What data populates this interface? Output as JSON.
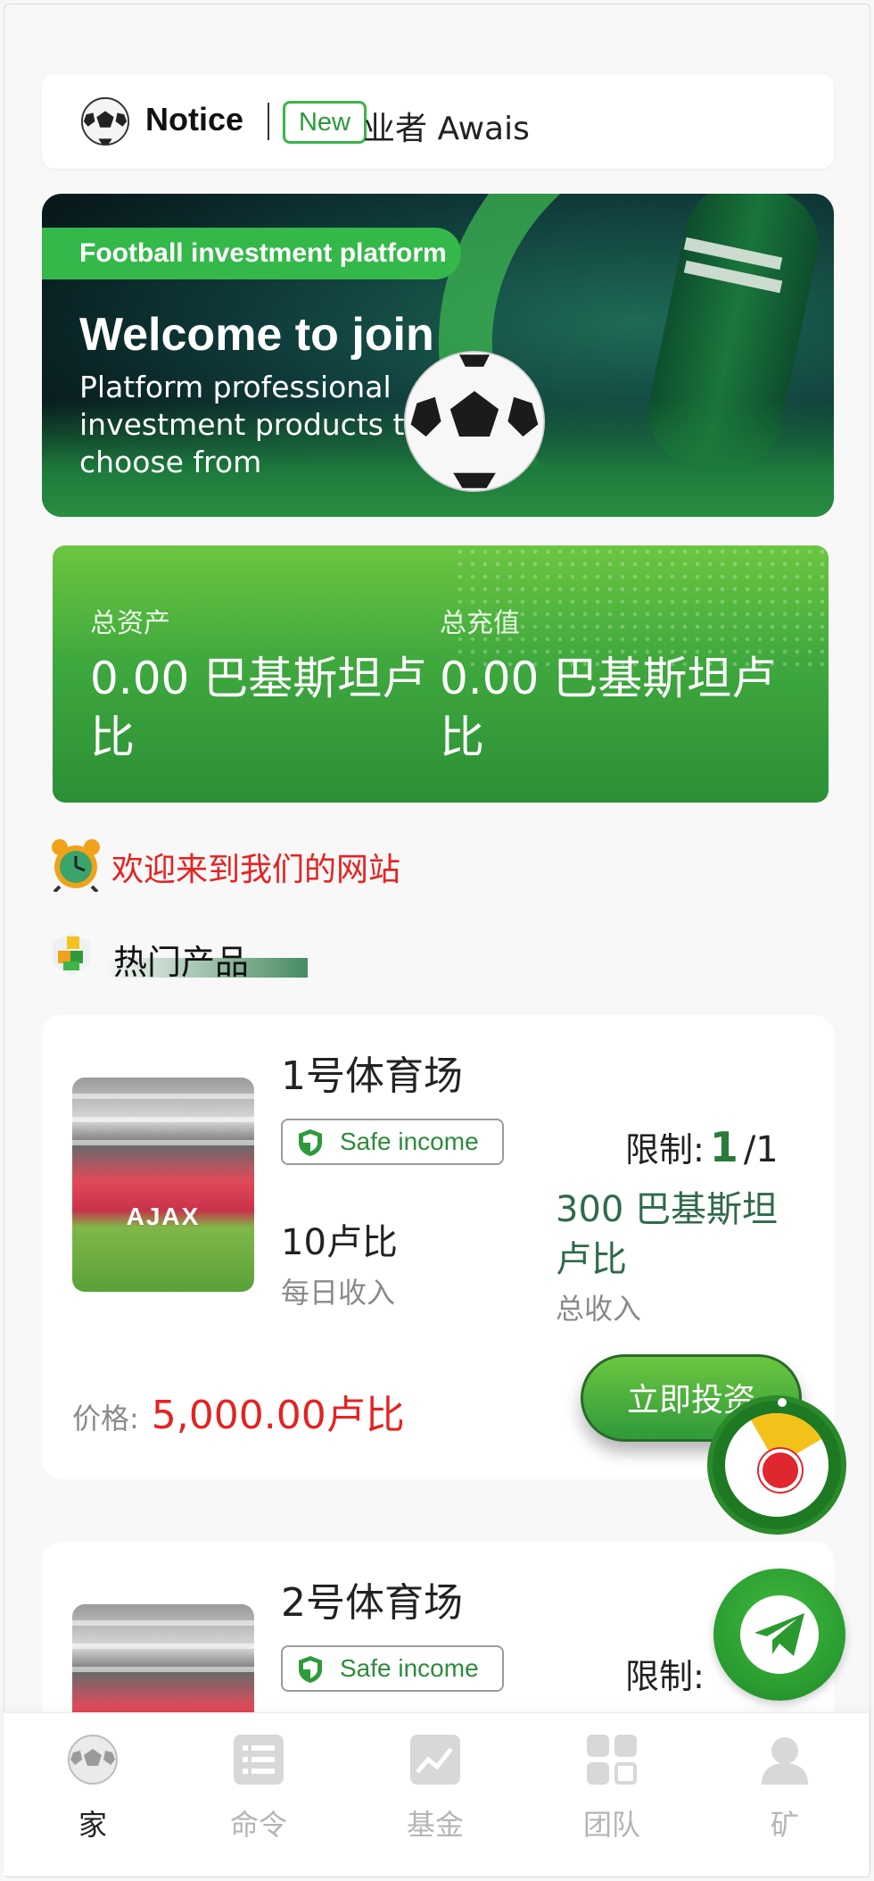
{
  "notice": {
    "title": "Notice",
    "badge": "New",
    "marquee": "业者 Awais"
  },
  "banner": {
    "tag": "Football investment platform",
    "headline": "Welcome to join",
    "subtitle": "Platform professional investment products to choose from"
  },
  "assets": {
    "total_assets_label": "总资产",
    "total_assets_value": "0.00 巴基斯坦卢比",
    "total_recharge_label": "总充值",
    "total_recharge_value": "0.00 巴基斯坦卢比"
  },
  "welcome_text": "欢迎来到我们的网站",
  "hot_products_title": "热门产品",
  "products": [
    {
      "name": "1号体育场",
      "safe_label": "Safe income",
      "limit_label": "限制:",
      "limit_used": "1",
      "limit_total": "/1",
      "daily_value": "10卢比",
      "daily_label": "每日收入",
      "total_value": "300 巴基斯坦卢比",
      "total_label": "总收入",
      "price_label": "价格:",
      "price_value": "5,000.00卢比",
      "invest_label": "立即投资",
      "image_text": "AJAX"
    },
    {
      "name": "2号体育场",
      "safe_label": "Safe income",
      "limit_label": "限制:",
      "image_text": ""
    }
  ],
  "nav": [
    {
      "label": "家",
      "icon": "soccer-ball-icon",
      "active": true
    },
    {
      "label": "命令",
      "icon": "list-icon",
      "active": false
    },
    {
      "label": "基金",
      "icon": "chart-icon",
      "active": false
    },
    {
      "label": "团队",
      "icon": "grid-icon",
      "active": false
    },
    {
      "label": "矿",
      "icon": "user-icon",
      "active": false
    }
  ],
  "colors": {
    "accent_green": "#3fa83d",
    "price_red": "#e52222",
    "limit_green": "#2a7a3a"
  }
}
